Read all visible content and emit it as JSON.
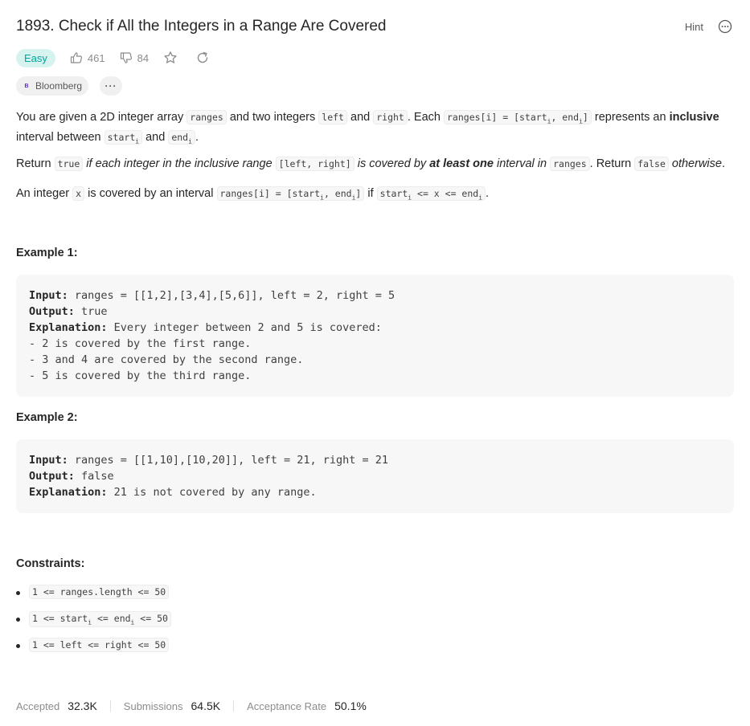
{
  "problem": {
    "title": "1893. Check if All the Integers in a Range Are Covered",
    "difficulty": "Easy",
    "likes": "461",
    "dislikes": "84",
    "hint_label": "Hint",
    "company_tag": "Bloomberg",
    "company_logo_letter": "B",
    "more_tags": "···"
  },
  "description": {
    "p1": {
      "t1": "You are given a 2D integer array ",
      "c1": "ranges",
      "t2": " and two integers ",
      "c2": "left",
      "t3": " and ",
      "c3": "right",
      "t4": ". Each ",
      "c4a": "ranges[i] = [start",
      "c4sub1": "i",
      "c4b": ", end",
      "c4sub2": "i",
      "c4c": "]",
      "t5": " represents an ",
      "b1": "inclusive",
      "t6": " interval between ",
      "c5a": "start",
      "c5sub": "i",
      "t7": " and ",
      "c6a": "end",
      "c6sub": "i",
      "t8": "."
    },
    "p2": {
      "t1": "Return ",
      "c1": "true",
      "i1": " if each integer in the inclusive range ",
      "c2": "[left, right]",
      "i2": " is covered by ",
      "b1": "at least one",
      "i3": " interval in ",
      "c3": "ranges",
      "t2": ". Return ",
      "c4": "false",
      "i4": " otherwise",
      "t3": "."
    },
    "p3": {
      "t1": "An integer ",
      "c1": "x",
      "t2": " is covered by an interval ",
      "c2a": "ranges[i] = [start",
      "c2sub1": "i",
      "c2b": ", end",
      "c2sub2": "i",
      "c2c": "]",
      "t3": " if ",
      "c3a": "start",
      "c3sub1": "i",
      "c3b": " <= x <= end",
      "c3sub2": "i",
      "t4": "."
    }
  },
  "examples": [
    {
      "heading": "Example 1:",
      "input_label": "Input:",
      "input": " ranges = [[1,2],[3,4],[5,6]], left = 2, right = 5",
      "output_label": "Output:",
      "output": " true",
      "explanation_label": "Explanation:",
      "explanation": " Every integer between 2 and 5 is covered:",
      "lines": [
        "- 2 is covered by the first range.",
        "- 3 and 4 are covered by the second range.",
        "- 5 is covered by the third range."
      ]
    },
    {
      "heading": "Example 2:",
      "input_label": "Input:",
      "input": " ranges = [[1,10],[10,20]], left = 21, right = 21",
      "output_label": "Output:",
      "output": " false",
      "explanation_label": "Explanation:",
      "explanation": " 21 is not covered by any range."
    }
  ],
  "constraints": {
    "heading": "Constraints:",
    "c1": "1 <= ranges.length <= 50",
    "c2a": "1 <= start",
    "c2sub1": "i",
    "c2b": " <= end",
    "c2sub2": "i",
    "c2c": " <= 50",
    "c3": "1 <= left <= right <= 50"
  },
  "stats": {
    "accepted_label": "Accepted",
    "accepted_value": "32.3K",
    "submissions_label": "Submissions",
    "submissions_value": "64.5K",
    "rate_label": "Acceptance Rate",
    "rate_value": "50.1%"
  },
  "colors": {
    "easy_text": "#00a69c",
    "easy_bg": "#d7f3f0",
    "code_bg": "#f7f7f7",
    "icons": "#8c8c8c"
  },
  "icons": [
    "thumbs-up-icon",
    "thumbs-down-icon",
    "star-icon",
    "share-icon",
    "more-circle-icon"
  ]
}
